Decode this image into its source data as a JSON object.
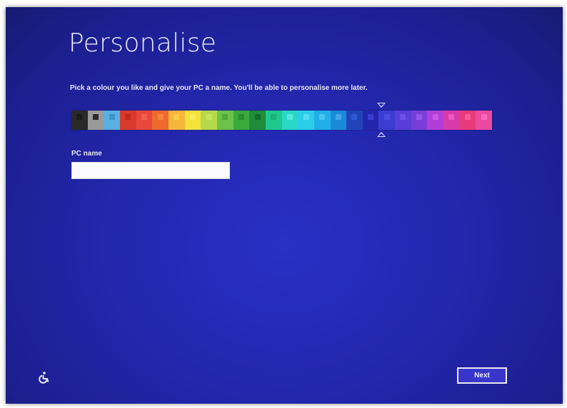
{
  "page": {
    "title": "Personalise",
    "subtitle": "Pick a colour you like and give your PC a name. You'll be able to personalise more later."
  },
  "palette": {
    "selected_index": 18,
    "swatches": [
      {
        "bg": "#2a2a2a",
        "chip": "#1a1a1a"
      },
      {
        "bg": "#9a9a9a",
        "chip": "#2a2a2a"
      },
      {
        "bg": "#5ab0e0",
        "chip": "#3d94c9"
      },
      {
        "bg": "#d83a2c",
        "chip": "#c22a1e"
      },
      {
        "bg": "#e8483a",
        "chip": "#f06050"
      },
      {
        "bg": "#ec6a2c",
        "chip": "#f7833e"
      },
      {
        "bg": "#f4b63a",
        "chip": "#f9cc4a"
      },
      {
        "bg": "#f2e23a",
        "chip": "#f7ec5a"
      },
      {
        "bg": "#b5d94a",
        "chip": "#c8e65c"
      },
      {
        "bg": "#6cc24a",
        "chip": "#4faa34"
      },
      {
        "bg": "#3aaa3c",
        "chip": "#2a8f2c"
      },
      {
        "bg": "#1e8c3a",
        "chip": "#126e2a"
      },
      {
        "bg": "#1ec98e",
        "chip": "#1ab07a"
      },
      {
        "bg": "#2ad8c6",
        "chip": "#55e8da"
      },
      {
        "bg": "#2ccde8",
        "chip": "#55dcf2"
      },
      {
        "bg": "#22aee8",
        "chip": "#4cc2f0"
      },
      {
        "bg": "#1a8ad8",
        "chip": "#44a4e8"
      },
      {
        "bg": "#2244b8",
        "chip": "#2f5ad6"
      },
      {
        "bg": "#2326ac",
        "chip": "#3a3ed0"
      },
      {
        "bg": "#3a3ed0",
        "chip": "#4a4ee0"
      },
      {
        "bg": "#5a3ed8",
        "chip": "#6e52e6"
      },
      {
        "bg": "#7a3ed8",
        "chip": "#9058e8"
      },
      {
        "bg": "#b23ed8",
        "chip": "#c85aea"
      },
      {
        "bg": "#d83aa8",
        "chip": "#ea5ac0"
      },
      {
        "bg": "#e83a78",
        "chip": "#f45a94"
      },
      {
        "bg": "#ec4aa0",
        "chip": "#f66ab8"
      }
    ]
  },
  "pc_name": {
    "label": "PC name",
    "value": ""
  },
  "footer": {
    "ease_icon": "ease-of-access-icon",
    "next_label": "Next"
  }
}
